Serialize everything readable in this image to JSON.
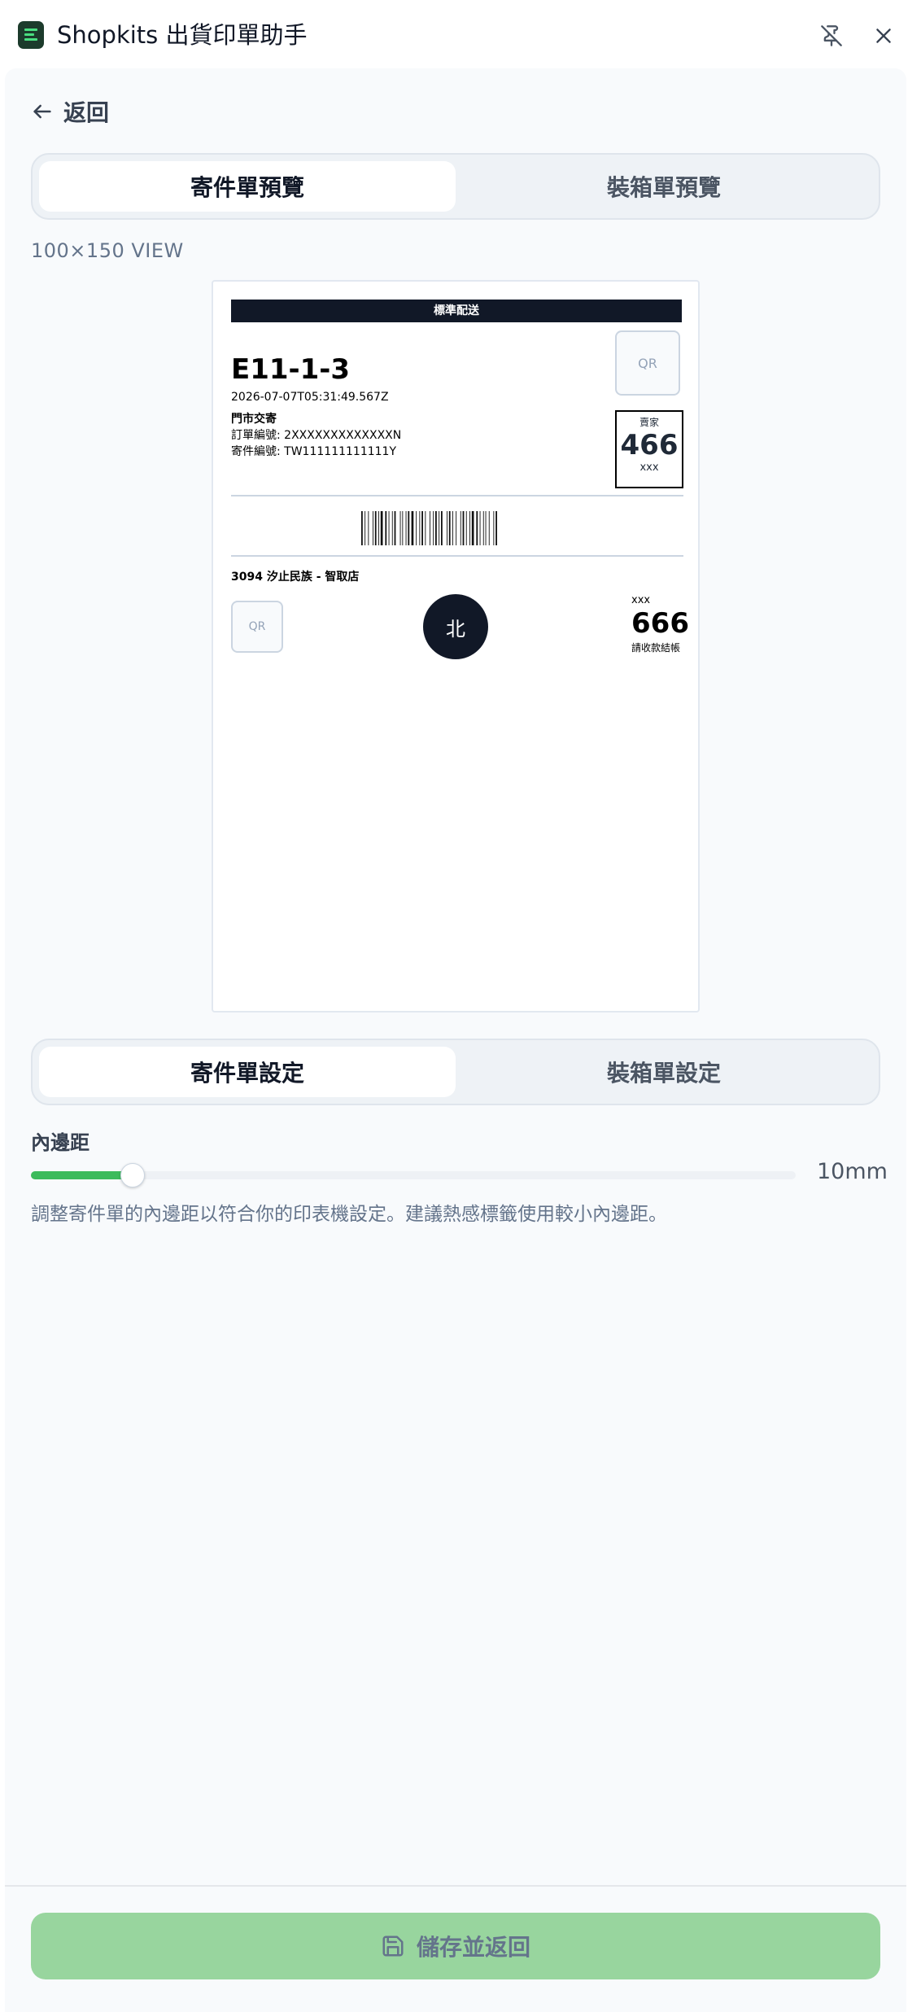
{
  "window": {
    "title": "Shopkits 出貨印單助手",
    "pin_icon": "pin-off-icon",
    "close_icon": "close-icon"
  },
  "back": {
    "label": "返回",
    "icon": "arrow-left-icon"
  },
  "preview_tabs": [
    {
      "label": "寄件單預覽",
      "active": true
    },
    {
      "label": "裝箱單預覽",
      "active": false
    }
  ],
  "view_label": "100×150 VIEW",
  "label_preview": {
    "banner": "標準配送",
    "code": "E11-1-3",
    "timestamp": "2026-07-07T05:31:49.567Z",
    "method": "門市交寄",
    "order_no": "訂單編號: 2XXXXXXXXXXXXXN",
    "ship_no": "寄件編號: TW111111111111Y",
    "qr_label": "QR",
    "seller": {
      "title": "賣家",
      "number": "466",
      "sub": "xxx"
    },
    "store": "3094 汐止民族 - 智取店",
    "region": "北",
    "right": {
      "top": "xxx",
      "number": "666",
      "note": "請收款結帳"
    }
  },
  "settings_tabs": [
    {
      "label": "寄件單設定",
      "active": true
    },
    {
      "label": "裝箱單設定",
      "active": false
    }
  ],
  "padding_setting": {
    "label": "內邊距",
    "value_text": "10mm",
    "slider_fraction": 0.133,
    "help": "調整寄件單的內邊距以符合你的印表機設定。建議熱感標籤使用較小內邊距。"
  },
  "save_button": {
    "label": "儲存並返回",
    "icon": "save-icon"
  },
  "colors": {
    "accent": "#3dbb5c",
    "save_bg": "#98d59e",
    "dark": "#111827"
  }
}
